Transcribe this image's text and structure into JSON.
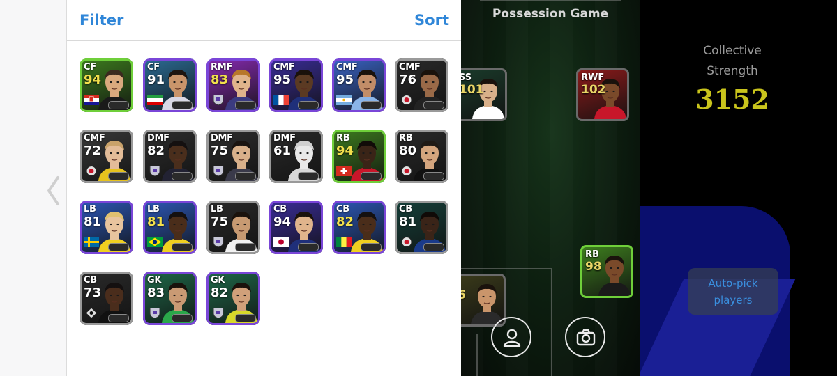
{
  "panel": {
    "filter_label": "Filter",
    "sort_label": "Sort"
  },
  "players": [
    {
      "pos": "CF",
      "rating": "94",
      "border": "#6fcf3a",
      "bg": "#3d7d1e",
      "face": "#d9a97e",
      "hair": "#3b2a1f",
      "shirt": "#1a1a1a",
      "badge": "croatia-flag",
      "rc": "#f2e04c"
    },
    {
      "pos": "CF",
      "rating": "91",
      "border": "#7a46d8",
      "bg": "#2c6d96",
      "face": "#c9956b",
      "hair": "#1e1610",
      "shirt": "#d9d9e6",
      "badge": "iran-flag",
      "rc": "#ffffff"
    },
    {
      "pos": "RMF",
      "rating": "83",
      "border": "#7a46d8",
      "bg": "#8a2bb5",
      "face": "#e0b48c",
      "hair": "#b8772a",
      "shirt": "#3b3b80",
      "badge": "club-crest-shield",
      "rc": "#f2e04c"
    },
    {
      "pos": "CMF",
      "rating": "95",
      "border": "#7a46d8",
      "bg": "#3a2d9a",
      "face": "#5b3a23",
      "hair": "#1a110b",
      "shirt": "#1f2f7a",
      "badge": "france-flag",
      "rc": "#ffffff"
    },
    {
      "pos": "CMF",
      "rating": "95",
      "border": "#7a46d8",
      "bg": "#3b65c8",
      "face": "#c28d68",
      "hair": "#1a120c",
      "shirt": "#8ab4e8",
      "badge": "argentina-flag",
      "rc": "#ffffff"
    },
    {
      "pos": "CMF",
      "rating": "76",
      "border": "#9a9a9a",
      "bg": "#2a2a2a",
      "face": "#9a6a48",
      "hair": "#1a120b",
      "shirt": "#222222",
      "badge": "club-crest-round",
      "rc": "#ffffff"
    },
    {
      "pos": "CMF",
      "rating": "72",
      "border": "#9a9a9a",
      "bg": "#3a3a3a",
      "face": "#e3bc98",
      "hair": "#c9a26a",
      "shirt": "#e6c21e",
      "badge": "club-crest-round",
      "rc": "#ffffff"
    },
    {
      "pos": "DMF",
      "rating": "82",
      "border": "#9a9a9a",
      "bg": "#2e2e2e",
      "face": "#4a2e1c",
      "hair": "#141010",
      "shirt": "#222233",
      "badge": "club-crest-shield",
      "rc": "#ffffff"
    },
    {
      "pos": "DMF",
      "rating": "75",
      "border": "#9a9a9a",
      "bg": "#2e2e2e",
      "face": "#d8b08a",
      "hair": "#1a1410",
      "shirt": "#3a3a4a",
      "badge": "club-crest-shield",
      "rc": "#ffffff"
    },
    {
      "pos": "DMF",
      "rating": "61",
      "border": "#9a9a9a",
      "bg": "#2a2a2a",
      "face": "#e9e9e9",
      "hair": "#d0d0d0",
      "shirt": "#d8d8d8",
      "badge": "none",
      "rc": "#ffffff"
    },
    {
      "pos": "RB",
      "rating": "94",
      "border": "#6fcf3a",
      "bg": "#3d7d1e",
      "face": "#3a2417",
      "hair": "#110b08",
      "shirt": "#c8162a",
      "badge": "switzerland-flag",
      "rc": "#f2e04c"
    },
    {
      "pos": "RB",
      "rating": "80",
      "border": "#9a9a9a",
      "bg": "#2a2a2a",
      "face": "#d4a57e",
      "hair": "#1f1a16",
      "shirt": "#111111",
      "badge": "club-crest-round",
      "rc": "#ffffff"
    },
    {
      "pos": "LB",
      "rating": "81",
      "border": "#7a46d8",
      "bg": "#2c58b8",
      "face": "#e8c49e",
      "hair": "#e0c070",
      "shirt": "#f0d020",
      "badge": "sweden-flag",
      "rc": "#ffffff"
    },
    {
      "pos": "LB",
      "rating": "81",
      "border": "#7a46d8",
      "bg": "#2c58b8",
      "face": "#4a2d1a",
      "hair": "#141010",
      "shirt": "#f0d020",
      "badge": "brazil-flag",
      "rc": "#f2e04c"
    },
    {
      "pos": "LB",
      "rating": "75",
      "border": "#9a9a9a",
      "bg": "#2a2a2a",
      "face": "#c79a72",
      "hair": "#1a120c",
      "shirt": "#f2f2f2",
      "badge": "club-crest-shield",
      "rc": "#ffffff"
    },
    {
      "pos": "CB",
      "rating": "94",
      "border": "#7a46d8",
      "bg": "#3a2d9a",
      "face": "#e0b48c",
      "hair": "#1a120c",
      "shirt": "#1f2f7a",
      "badge": "japan-flag",
      "rc": "#ffffff"
    },
    {
      "pos": "CB",
      "rating": "82",
      "border": "#7a46d8",
      "bg": "#2c58b8",
      "face": "#4a2d1a",
      "hair": "#141010",
      "shirt": "#f0d020",
      "badge": "senegal-flag",
      "rc": "#f2e04c"
    },
    {
      "pos": "CB",
      "rating": "81",
      "border": "#9a9a9a",
      "bg": "#15403a",
      "face": "#3a2418",
      "hair": "#100a07",
      "shirt": "#1a3a8a",
      "badge": "club-crest-round",
      "rc": "#ffffff"
    },
    {
      "pos": "CB",
      "rating": "73",
      "border": "#9a9a9a",
      "bg": "#2a2a2a",
      "face": "#4a2d1c",
      "hair": "#141010",
      "shirt": "#111111",
      "badge": "club-crest-diamond",
      "rc": "#ffffff"
    },
    {
      "pos": "GK",
      "rating": "83",
      "border": "#7a46d8",
      "bg": "#1e6a4a",
      "face": "#c99a74",
      "hair": "#1a120c",
      "shirt": "#2aa84a",
      "badge": "club-crest-shield",
      "rc": "#ffffff"
    },
    {
      "pos": "GK",
      "rating": "82",
      "border": "#7a46d8",
      "bg": "#1e6a4a",
      "face": "#d0a07a",
      "hair": "#1a120c",
      "shirt": "#d8d82a",
      "badge": "club-crest-shield",
      "rc": "#ffffff"
    }
  ],
  "pitch": {
    "title": "Possession Game",
    "cards": [
      {
        "pos": "SS",
        "rating": "101",
        "border": "#6a6a6a",
        "bg": "#1a3a2a",
        "face": "#d8b08a",
        "shirt": "#ffffff"
      },
      {
        "pos": "RWF",
        "rating": "102",
        "border": "#6a6a6a",
        "bg": "#8a1a1a",
        "face": "#7a4a2a",
        "shirt": "#c8162a"
      },
      {
        "pos": "RB",
        "rating": "98",
        "border": "#6fcf3a",
        "bg": "#3d7d1e",
        "face": "#7a4a2a",
        "shirt": "#1a1a1a"
      },
      {
        "pos": "",
        "rating": "6",
        "border": "#6a6a6a",
        "bg": "#3a3a1a",
        "face": "#c9956b",
        "shirt": "#2a2a2a"
      }
    ],
    "profile_button_icon": "person-icon",
    "camera_button_icon": "camera-icon"
  },
  "right": {
    "collective_label": "Collective Strength",
    "collective_value": "3152",
    "autopick_label": "Auto-pick players"
  }
}
